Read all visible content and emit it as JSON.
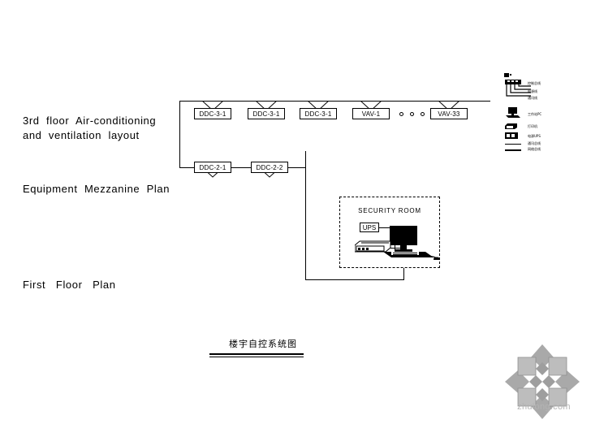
{
  "drawing": {
    "title": "楼宇自控系统图",
    "watermark": "zhulong.com"
  },
  "plans": [
    {
      "id": "floor3",
      "label": "3rd  floor  Air-conditioning\nand  ventilation  layout"
    },
    {
      "id": "mezzanine",
      "label": "Equipment  Mezzanine  Plan"
    },
    {
      "id": "first",
      "label": "First   Floor   Plan"
    }
  ],
  "controllers": {
    "row_floor3": [
      {
        "name": "DDC-3-1"
      },
      {
        "name": "DDC-3-1"
      },
      {
        "name": "DDC-3-1"
      },
      {
        "name": "VAV-1"
      },
      {
        "name": "VAV-33"
      }
    ],
    "row_mezzanine": [
      {
        "name": "DDC-2-1"
      },
      {
        "name": "DDC-2-2"
      }
    ],
    "ellipsis": "• • •"
  },
  "security_room": {
    "title": "SECURITY ROOM",
    "ups_label": "UPS",
    "devices": [
      {
        "name": "workstation-monitor"
      },
      {
        "name": "keyboard"
      },
      {
        "name": "mouse"
      },
      {
        "name": "printer"
      },
      {
        "name": "ups"
      }
    ]
  },
  "legend": {
    "items": [
      {
        "key": "bus-top",
        "label": "控制总线"
      },
      {
        "key": "bus-mid",
        "label": "电源线"
      },
      {
        "key": "bus-bot",
        "label": "通讯线"
      },
      {
        "key": "workstation",
        "label": "工作站PC"
      },
      {
        "key": "printer",
        "label": "打印机"
      },
      {
        "key": "ups",
        "label": "电源UPS"
      },
      {
        "key": "line1",
        "label": "通讯总线"
      },
      {
        "key": "line2",
        "label": "网络总线"
      }
    ]
  },
  "colors": {
    "ink": "#000000",
    "paper": "#ffffff",
    "watermark": "#a9a9a9",
    "watermark_text": "#b4b4b4"
  }
}
